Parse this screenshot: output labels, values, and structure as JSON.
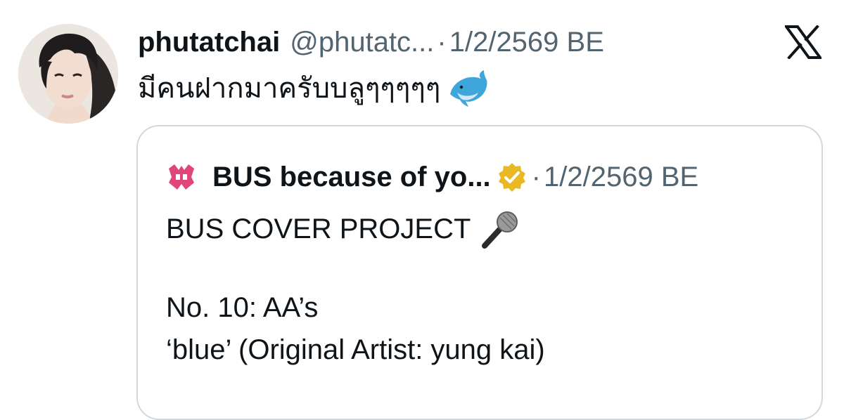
{
  "tweet": {
    "display_name": "phutatchai",
    "handle": "@phutatc...",
    "separator": "·",
    "timestamp": "1/2/2569 BE",
    "text": "มีคนฝากมาครับบลูๆๆๆๆๆ",
    "emoji_icon": "dolphin-icon",
    "avatar_icon": "profile-photo"
  },
  "close_icon": "x-logo-icon",
  "quote": {
    "display_name": "BUS because of yo...",
    "separator": "·",
    "timestamp": "1/2/2569 BE",
    "verified_icon": "gold-verified-badge-icon",
    "avatar_icon": "pink-bus-logo-icon",
    "lines": [
      "BUS COVER PROJECT",
      "No. 10: AA’s",
      "‘blue’ (Original Artist: yung kai)"
    ],
    "line1_emoji_icon": "microphone-icon"
  },
  "colors": {
    "text": "#0f1419",
    "muted": "#536471",
    "border": "#cfd9de",
    "verified": "#e8b923",
    "brand_pink": "#e0457b"
  }
}
